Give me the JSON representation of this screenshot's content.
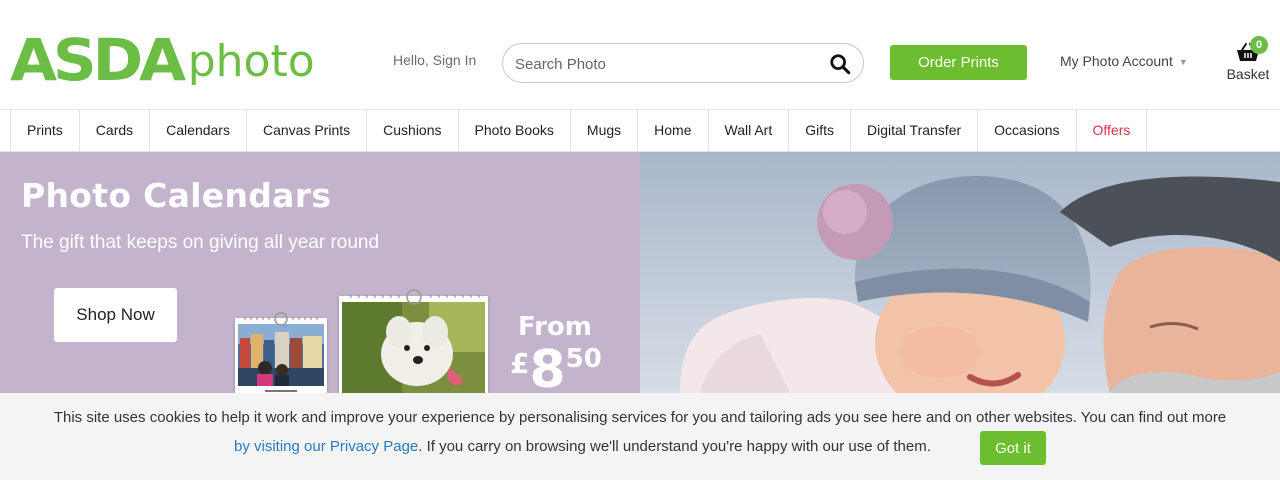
{
  "header": {
    "logo_brand": "ASDA",
    "logo_product": "photo",
    "signin_label": "Hello, Sign In",
    "search_placeholder": "Search Photo",
    "order_label": "Order Prints",
    "account_label": "My Photo Account",
    "basket_count": "0",
    "basket_label": "Basket"
  },
  "nav": {
    "items": [
      {
        "label": "Prints"
      },
      {
        "label": "Cards"
      },
      {
        "label": "Calendars"
      },
      {
        "label": "Canvas Prints"
      },
      {
        "label": "Cushions"
      },
      {
        "label": "Photo Books"
      },
      {
        "label": "Mugs"
      },
      {
        "label": "Home"
      },
      {
        "label": "Wall Art"
      },
      {
        "label": "Gifts"
      },
      {
        "label": "Digital Transfer"
      },
      {
        "label": "Occasions"
      },
      {
        "label": "Offers"
      }
    ]
  },
  "hero": {
    "title": "Photo Calendars",
    "subtitle": "The gift that keeps on giving all year round",
    "cta_label": "Shop Now",
    "from_label": "From",
    "price_currency": "£",
    "price_pounds": "8",
    "price_pence": "50"
  },
  "cookie": {
    "line1": "This site uses cookies to help it work and improve your experience by personalising services for you and tailoring ads you see here and on other websites. You can find out more",
    "link_text": "by visiting our Privacy Page",
    "line2_rest": ". If you carry on browsing we'll understand you're happy with our use of them.",
    "button_label": "Got it"
  },
  "colors": {
    "brand_green": "#6cbd45",
    "button_green": "#6cbd2f",
    "hero_lilac": "#c3b3cd",
    "offers_red": "#d9334a",
    "link_blue": "#2a7bbf"
  }
}
